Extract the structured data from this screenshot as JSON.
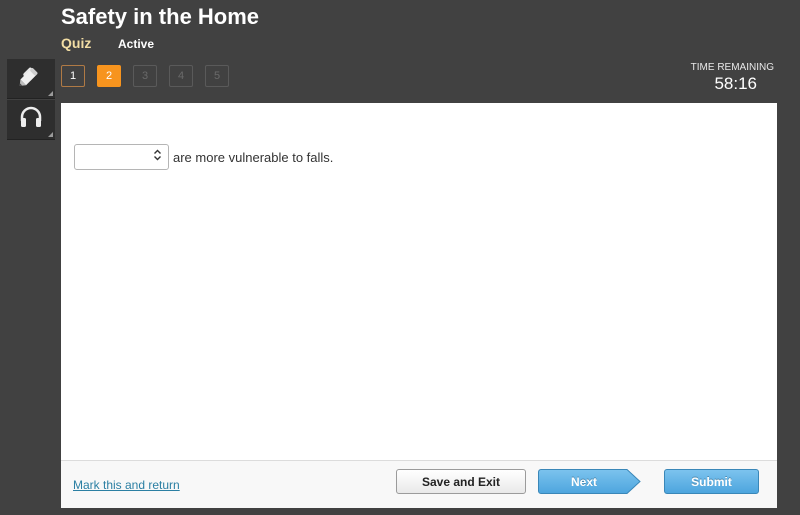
{
  "header": {
    "title": "Safety in the Home",
    "type_label": "Quiz",
    "status_label": "Active"
  },
  "question_nav": [
    {
      "label": "1",
      "state": "visited"
    },
    {
      "label": "2",
      "state": "current"
    },
    {
      "label": "3",
      "state": "unvisited"
    },
    {
      "label": "4",
      "state": "unvisited"
    },
    {
      "label": "5",
      "state": "unvisited"
    }
  ],
  "timer": {
    "label": "TIME REMAINING",
    "value": "58:16"
  },
  "tools": [
    {
      "name": "pencil-icon"
    },
    {
      "name": "headphones-icon"
    }
  ],
  "question": {
    "dropdown_value": "",
    "text": "are more vulnerable to falls."
  },
  "footer": {
    "mark_link": "Mark this and return",
    "save_label": "Save and Exit",
    "next_label": "Next",
    "submit_label": "Submit"
  },
  "colors": {
    "accent_orange": "#f7941e",
    "button_blue": "#5aaee3",
    "link_blue": "#2b7fa3",
    "quiz_label": "#f3dea4"
  }
}
